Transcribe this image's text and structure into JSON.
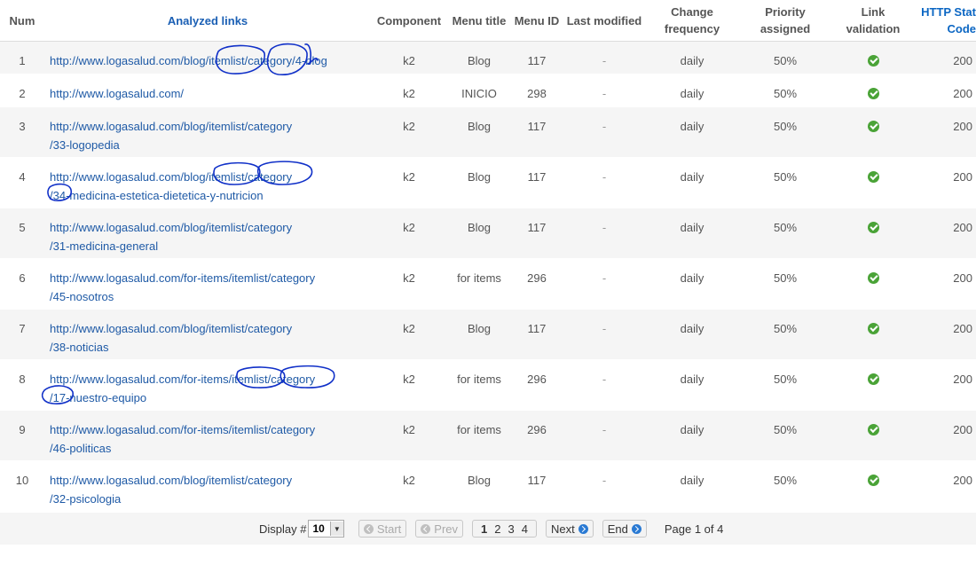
{
  "table": {
    "headers": {
      "num": "Num",
      "links": "Analyzed links",
      "component": "Component",
      "menu_title": "Menu title",
      "menu_id": "Menu ID",
      "last_modified": "Last modified",
      "change_frequency": "Change frequency",
      "priority": "Priority assigned",
      "link_validation": "Link validation",
      "http_code": "HTTP Stat Code"
    },
    "rows": [
      {
        "num": "1",
        "link1": "http://www.logasalud.com/blog/itemlist/category/4-blog",
        "link2": "",
        "component": "k2",
        "menu_title": "Blog",
        "menu_id": "117",
        "last_modified": "-",
        "change_frequency": "daily",
        "priority": "50%",
        "http_code": "200"
      },
      {
        "num": "2",
        "link1": "http://www.logasalud.com/",
        "link2": "",
        "component": "k2",
        "menu_title": "INICIO",
        "menu_id": "298",
        "last_modified": "-",
        "change_frequency": "daily",
        "priority": "50%",
        "http_code": "200"
      },
      {
        "num": "3",
        "link1": "http://www.logasalud.com/blog/itemlist/category",
        "link2": "/33-logopedia",
        "component": "k2",
        "menu_title": "Blog",
        "menu_id": "117",
        "last_modified": "-",
        "change_frequency": "daily",
        "priority": "50%",
        "http_code": "200"
      },
      {
        "num": "4",
        "link1": "http://www.logasalud.com/blog/itemlist/category",
        "link2": "/34-medicina-estetica-dietetica-y-nutricion",
        "component": "k2",
        "menu_title": "Blog",
        "menu_id": "117",
        "last_modified": "-",
        "change_frequency": "daily",
        "priority": "50%",
        "http_code": "200"
      },
      {
        "num": "5",
        "link1": "http://www.logasalud.com/blog/itemlist/category",
        "link2": "/31-medicina-general",
        "component": "k2",
        "menu_title": "Blog",
        "menu_id": "117",
        "last_modified": "-",
        "change_frequency": "daily",
        "priority": "50%",
        "http_code": "200"
      },
      {
        "num": "6",
        "link1": "http://www.logasalud.com/for-items/itemlist/category",
        "link2": "/45-nosotros",
        "component": "k2",
        "menu_title": "for items",
        "menu_id": "296",
        "last_modified": "-",
        "change_frequency": "daily",
        "priority": "50%",
        "http_code": "200"
      },
      {
        "num": "7",
        "link1": "http://www.logasalud.com/blog/itemlist/category",
        "link2": "/38-noticias",
        "component": "k2",
        "menu_title": "Blog",
        "menu_id": "117",
        "last_modified": "-",
        "change_frequency": "daily",
        "priority": "50%",
        "http_code": "200"
      },
      {
        "num": "8",
        "link1": "http://www.logasalud.com/for-items/itemlist/category",
        "link2": "/17-nuestro-equipo",
        "component": "k2",
        "menu_title": "for items",
        "menu_id": "296",
        "last_modified": "-",
        "change_frequency": "daily",
        "priority": "50%",
        "http_code": "200"
      },
      {
        "num": "9",
        "link1": "http://www.logasalud.com/for-items/itemlist/category",
        "link2": "/46-politicas",
        "component": "k2",
        "menu_title": "for items",
        "menu_id": "296",
        "last_modified": "-",
        "change_frequency": "daily",
        "priority": "50%",
        "http_code": "200"
      },
      {
        "num": "10",
        "link1": "http://www.logasalud.com/blog/itemlist/category",
        "link2": "/32-psicologia",
        "component": "k2",
        "menu_title": "Blog",
        "menu_id": "117",
        "last_modified": "-",
        "change_frequency": "daily",
        "priority": "50%",
        "http_code": "200"
      }
    ]
  },
  "pagination": {
    "display_label": "Display #",
    "display_value": "10",
    "start_label": "Start",
    "prev_label": "Prev",
    "pages": [
      "1",
      "2",
      "3",
      "4"
    ],
    "current_page": "1",
    "next_label": "Next",
    "end_label": "End",
    "page_info": "Page 1 of 4"
  },
  "colors": {
    "link": "#1f5aa6",
    "header_link": "#1a5fb4",
    "check": "#4aa337",
    "annotation": "#1030c8",
    "row_stripe": "#f5f5f5"
  },
  "icons": {
    "link_validation": "check-circle-icon",
    "start": "arrow-left-circle-icon",
    "prev": "arrow-left-circle-icon",
    "next": "arrow-right-circle-icon",
    "end": "arrow-right-circle-icon",
    "select": "dropdown-arrow-icon"
  }
}
